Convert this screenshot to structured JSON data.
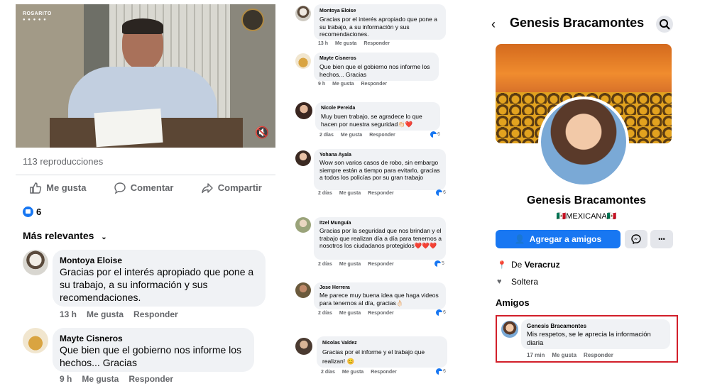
{
  "video": {
    "channel_logo": "ROSARITO",
    "views": "113 reproducciones"
  },
  "left_actions": {
    "like": "Me gusta",
    "comment": "Comentar",
    "share": "Compartir"
  },
  "reaction_count": "6",
  "sort_label": "Más relevantes",
  "left_comments": [
    {
      "name": "Montoya Eloise",
      "text": "Gracias por el interés apropiado que pone a su trabajo, a su información y sus recomendaciones.",
      "time": "13 h",
      "like": "Me gusta",
      "reply": "Responder"
    },
    {
      "name": "Mayte Cisneros",
      "text": "Que bien que el gobierno nos informe los hechos... Gracias",
      "time": "9 h",
      "like": "Me gusta",
      "reply": "Responder"
    }
  ],
  "mid_comments": [
    {
      "name": "Montoya Eloise",
      "text": "Gracias por el interés apropiado que pone a su trabajo, a su información y sus recomendaciones.",
      "time": "13 h",
      "like": "Me gusta",
      "reply": "Responder",
      "count": ""
    },
    {
      "name": "Mayte Cisneros",
      "text": "Que bien que el gobierno nos informe los hechos... Gracias",
      "time": "9 h",
      "like": "Me gusta",
      "reply": "Responder",
      "count": ""
    },
    {
      "name": "Nicole Pereida",
      "text": "Muy buen trabajo, se agradece lo que hacen por nuestra seguridad👏🏻❤️",
      "time": "2 días",
      "like": "Me gusta",
      "reply": "Responder",
      "count": "6"
    },
    {
      "name": "Yohana Ayala",
      "text": "Wow son varios casos de robo, sin embargo siempre están a tiempo para evitarlo, gracias a todos los policías por su gran trabajo",
      "time": "2 días",
      "like": "Me gusta",
      "reply": "Responder",
      "count": "6"
    },
    {
      "name": "Itzel Munguía",
      "text": "Gracias por la seguridad que nos brindan y el trabajo que realizan día a día para tenernos a nosotros los ciudadanos protegidos❤️❤️❤️",
      "time": "2 días",
      "like": "Me gusta",
      "reply": "Responder",
      "count": "5"
    },
    {
      "name": "Jose Herrera",
      "text": "Me parece muy buena idea que haga videos para tenernos al día, gracias👌🏻",
      "time": "2 días",
      "like": "Me gusta",
      "reply": "Responder",
      "count": "6"
    },
    {
      "name": "Nicolas Valdez",
      "text": "Gracias por el informe y el trabajo que realizan! 😊",
      "time": "2 días",
      "like": "Me gusta",
      "reply": "Responder",
      "count": "6"
    }
  ],
  "profile": {
    "header_title": "Genesis Bracamontes",
    "name": "Genesis Bracamontes",
    "nationality": "🇲🇽MEXICANA🇲🇽",
    "add_friend": "Agregar a amigos",
    "more": "•••",
    "location_prefix": "De ",
    "location": "Veracruz",
    "status": "Soltera",
    "friends_heading": "Amigos",
    "highlight_comment": {
      "name": "Genesis Bracamontes",
      "text": "Mis respetos, se le aprecia la información diaria",
      "time": "17 min",
      "like": "Me gusta",
      "reply": "Responder"
    }
  },
  "colors": {
    "accent": "#1877f2",
    "bubble": "#f0f2f5",
    "highlight_border": "#d21f2a",
    "meta_text": "#65676b"
  }
}
